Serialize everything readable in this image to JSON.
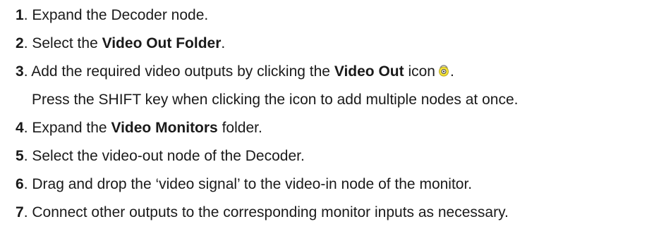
{
  "steps": [
    {
      "num": "1",
      "sep": ". ",
      "text": "Expand the Decoder node."
    },
    {
      "num": "2",
      "sep": ". ",
      "pre": "Select the ",
      "bold": "Video Out Folder",
      "post": "."
    },
    {
      "num": "3",
      "sep": ". ",
      "pre": "Add the required video outputs by clicking the ",
      "bold": "Video Out",
      "post_a": " icon",
      "post_b": ".",
      "icon": "video-out-icon"
    },
    {
      "note": "Press the SHIFT key when clicking the icon to add multiple nodes at once."
    },
    {
      "num": "4",
      "sep": ". ",
      "pre": "Expand the ",
      "bold": "Video Monitors",
      "post": " folder."
    },
    {
      "num": "5",
      "sep": ". ",
      "text": "Select the video-out node of the Decoder."
    },
    {
      "num": "6",
      "sep": ". ",
      "text": "Drag and drop the ‘video signal’ to the video-in node of the monitor."
    },
    {
      "num": "7",
      "sep": ". ",
      "text": "Connect other outputs to the corresponding monitor inputs as necessary."
    }
  ],
  "colors": {
    "text": "#1a1a1a",
    "icon_yellow": "#f5e23a",
    "icon_outline": "#8a8a8a"
  }
}
